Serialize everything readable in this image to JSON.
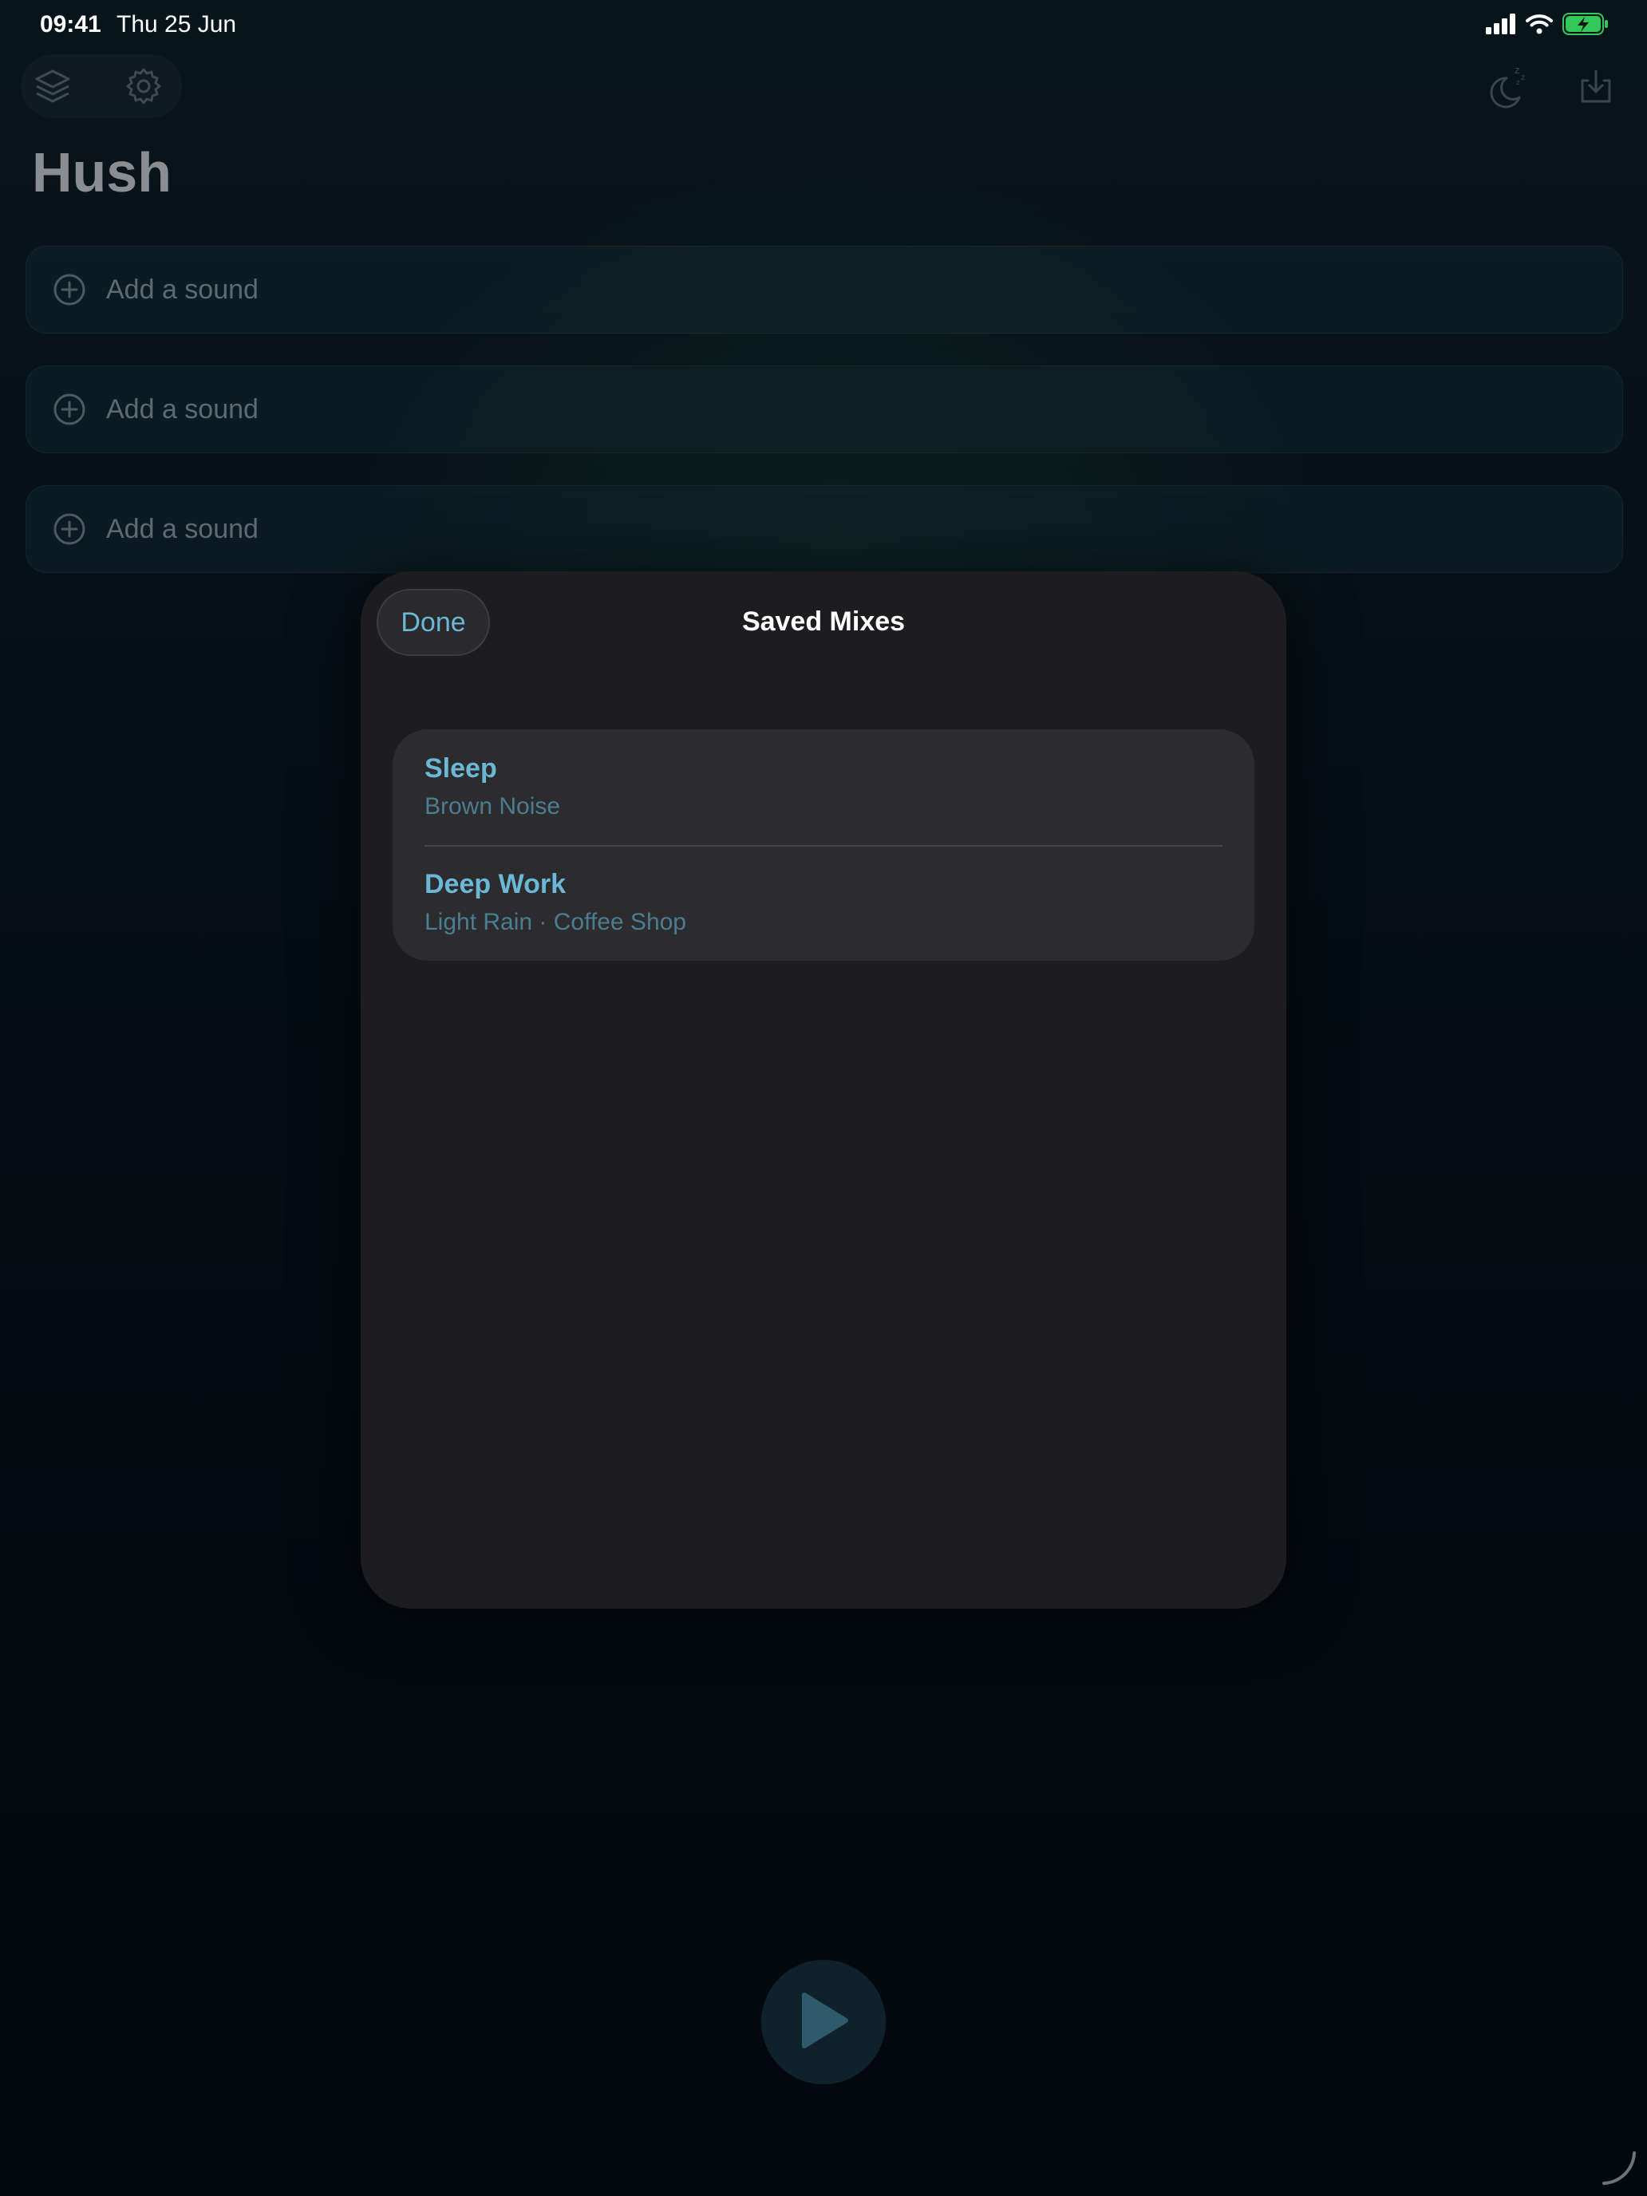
{
  "status_bar": {
    "time": "09:41",
    "date": "Thu 25 Jun",
    "icons": [
      "cellular-signal-icon",
      "wifi-icon",
      "battery-charging-icon"
    ]
  },
  "toolbar": {
    "left_icons": [
      "layers-icon",
      "gear-icon"
    ],
    "right_icons": [
      "sleep-timer-icon",
      "download-icon"
    ]
  },
  "app": {
    "title": "Hush"
  },
  "sound_slots": [
    {
      "label": "Add a sound",
      "icon": "plus-circle-icon"
    },
    {
      "label": "Add a sound",
      "icon": "plus-circle-icon"
    },
    {
      "label": "Add a sound",
      "icon": "plus-circle-icon"
    }
  ],
  "modal": {
    "title": "Saved Mixes",
    "done_label": "Done",
    "mixes": [
      {
        "name": "Sleep",
        "sounds": "Brown Noise"
      },
      {
        "name": "Deep Work",
        "sounds": "Light Rain · Coffee Shop"
      }
    ]
  },
  "player": {
    "play_icon": "play-icon"
  },
  "colors": {
    "accent": "#6bb8d6",
    "subtitle": "#4b7d92",
    "modal_bg": "#1d1d1f",
    "list_bg": "#2c2c2e",
    "battery": "#34c759"
  }
}
